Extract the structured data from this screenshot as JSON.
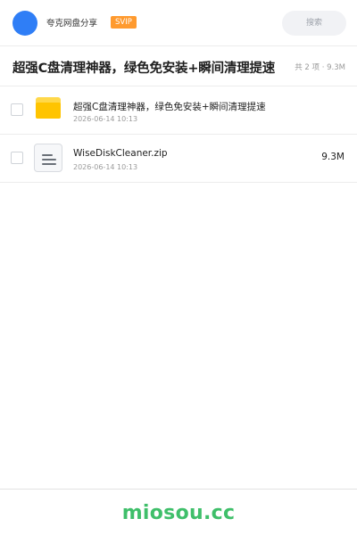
{
  "header": {
    "share_name": "夸克网盘分享",
    "badge": "SVIP",
    "search_label": "搜索"
  },
  "folder": {
    "title": "超强C盘清理神器，绿色免安装+瞬间清理提速",
    "meta": "共 2 项 · 9.3M"
  },
  "files": [
    {
      "name": "超强C盘清理神器，绿色免安装+瞬间清理提速",
      "date": "2026-06-14 10:13",
      "size": "",
      "icon": "folder-icon"
    },
    {
      "name": "WiseDiskCleaner.zip",
      "date": "2026-06-14 10:13",
      "size": "9.3M",
      "icon": "zip-file-icon"
    }
  ],
  "footer": {
    "brand": "miosou.cc"
  },
  "colors": {
    "avatar": "#2f7ef6",
    "badge": "#ff9a2e",
    "brand": "#3fbf6a",
    "folder": "#ffc400"
  }
}
